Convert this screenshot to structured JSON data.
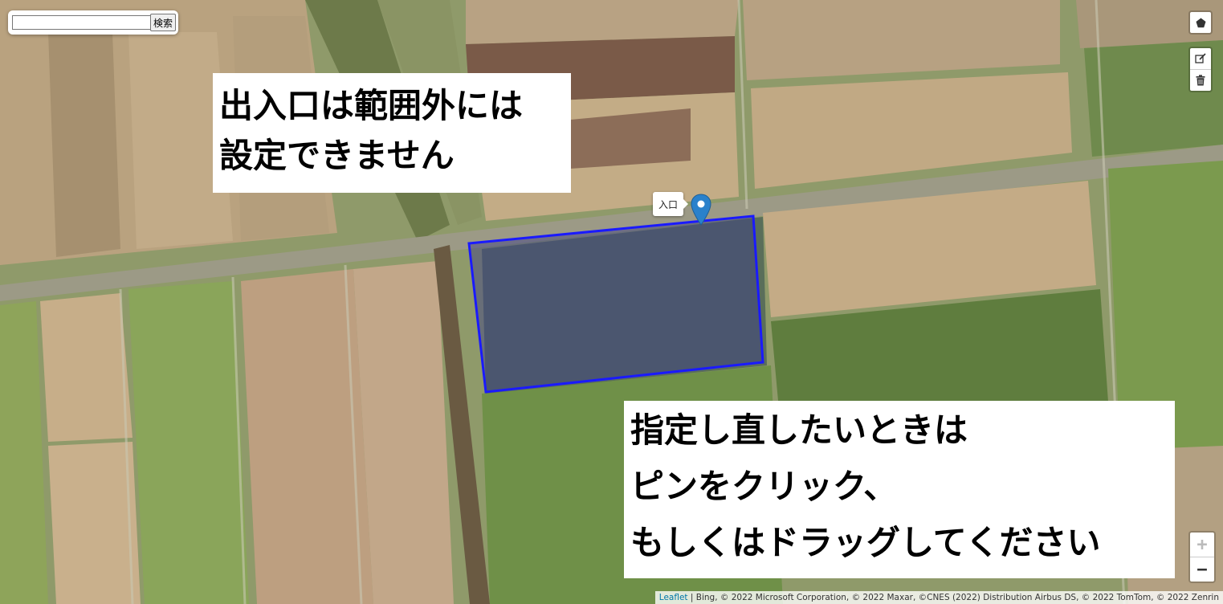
{
  "search": {
    "placeholder": "",
    "value": "",
    "button_label": "検索"
  },
  "draw_toolbar": {
    "polygon_icon": "pentagon-icon"
  },
  "edit_toolbar": {
    "edit_icon": "edit-layers-icon",
    "delete_icon": "trash-icon"
  },
  "zoom": {
    "in_label": "+",
    "out_label": "−"
  },
  "notes": {
    "top_left": [
      "出入口は範囲外には",
      "設定できません"
    ],
    "bottom_right": [
      "指定し直したいときは",
      "ピンをクリック、",
      "もしくはドラッグしてください"
    ]
  },
  "marker": {
    "tooltip": "入口",
    "color": "#2a81cb"
  },
  "polygon": {
    "stroke": "#1a1aff",
    "fill": "#3a3a8a"
  },
  "attribution": {
    "link": "Leaflet",
    "text": " | Bing, © 2022 Microsoft Corporation, © 2022 Maxar, ©CNES (2022) Distribution Airbus DS, © 2022 TomTom, © 2022 Zenrin"
  }
}
